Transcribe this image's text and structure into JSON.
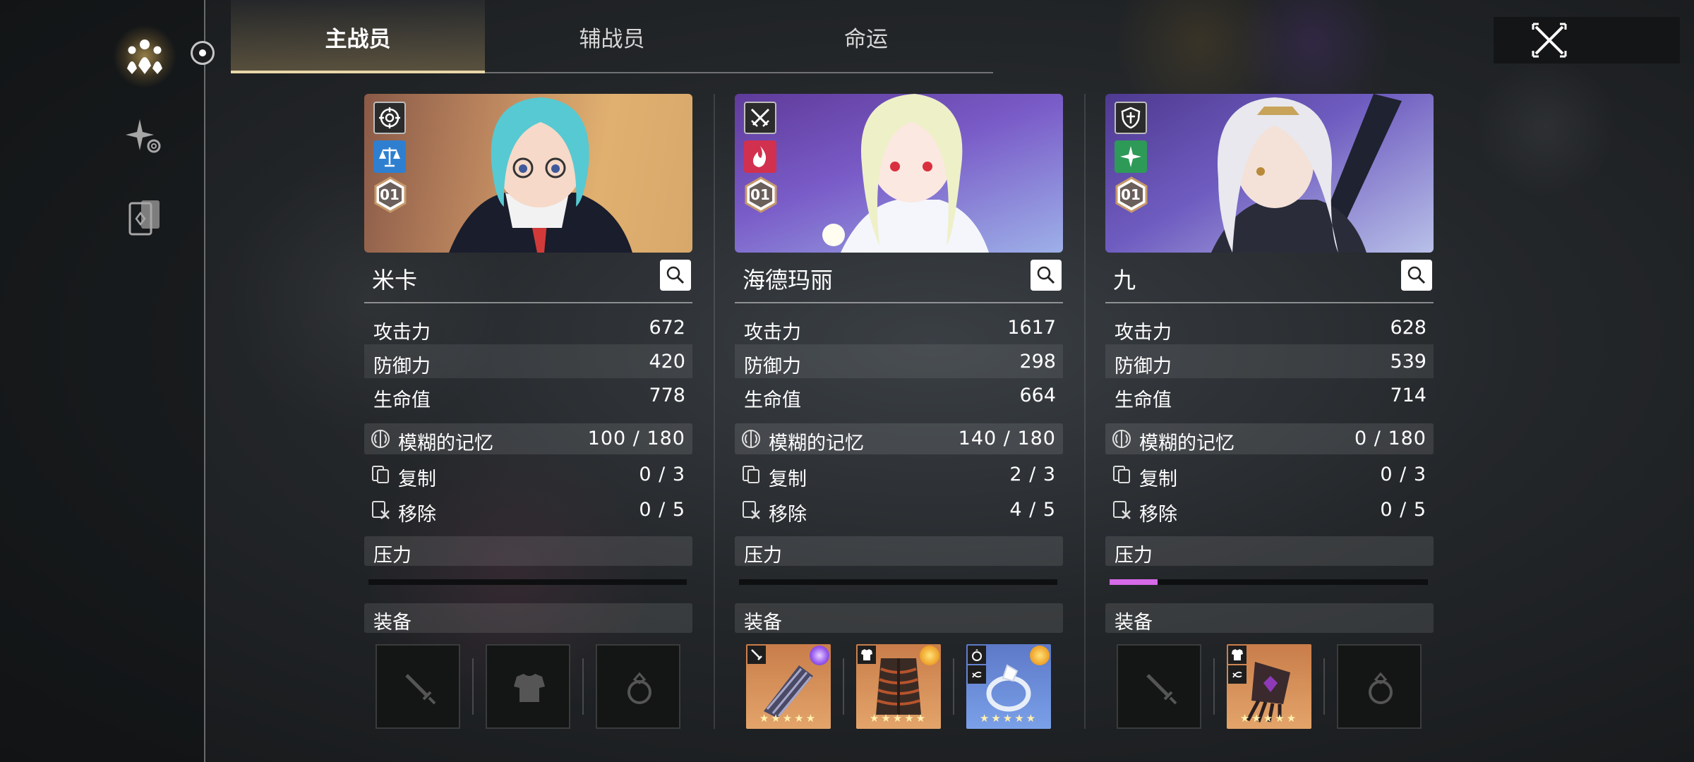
{
  "tabs": [
    {
      "label": "主战员",
      "active": true
    },
    {
      "label": "辅战员",
      "active": false
    },
    {
      "label": "命运",
      "active": false
    }
  ],
  "sidebar": {
    "items": [
      {
        "icon": "crew-icon",
        "active": true
      },
      {
        "icon": "sparkle-icon",
        "active": false
      },
      {
        "icon": "card-deck-icon",
        "active": false
      }
    ]
  },
  "colors": {
    "accent": "#e8d7a8",
    "stress_fill": "#d66ae8",
    "panel": "rgba(255,255,255,0.10)"
  },
  "characters": [
    {
      "name": "米卡",
      "class_icon": "target-icon",
      "element_icon": "scales-icon",
      "element_color": "#2f7fd0",
      "rank": "01",
      "stats": [
        {
          "label": "攻击力",
          "value": "672"
        },
        {
          "label": "防御力",
          "value": "420"
        },
        {
          "label": "生命值",
          "value": "778"
        }
      ],
      "memory": {
        "label": "模糊的记忆",
        "value": "100 / 180"
      },
      "copy": {
        "label": "复制",
        "value": "0 / 3"
      },
      "remove": {
        "label": "移除",
        "value": "0 / 5"
      },
      "stress": {
        "label": "压力",
        "level": 0
      },
      "equip_label": "装备",
      "equipment": [
        {
          "type": "weapon",
          "empty": true,
          "icon": "sword-icon"
        },
        {
          "type": "armor",
          "empty": true,
          "icon": "armor-icon"
        },
        {
          "type": "ring",
          "empty": true,
          "icon": "ring-icon"
        }
      ]
    },
    {
      "name": "海德玛丽",
      "class_icon": "crossed-swords-icon",
      "element_icon": "flame-icon",
      "element_color": "#d2304f",
      "rank": "01",
      "stats": [
        {
          "label": "攻击力",
          "value": "1617"
        },
        {
          "label": "防御力",
          "value": "298"
        },
        {
          "label": "生命值",
          "value": "664"
        }
      ],
      "memory": {
        "label": "模糊的记忆",
        "value": "140 / 180"
      },
      "copy": {
        "label": "复制",
        "value": "2 / 3"
      },
      "remove": {
        "label": "移除",
        "value": "4 / 5"
      },
      "stress": {
        "label": "压力",
        "level": 0
      },
      "equip_label": "装备",
      "equipment": [
        {
          "type": "weapon",
          "empty": false,
          "rarity": "orange",
          "art": "gauntlet-icon",
          "badge": "swirl",
          "stars": "★★★★★"
        },
        {
          "type": "armor",
          "empty": false,
          "rarity": "orange",
          "art": "ribcage-armor-icon",
          "badge": "sun",
          "stars": "★★★★★"
        },
        {
          "type": "ring",
          "empty": false,
          "rarity": "blue",
          "art": "diamond-ring-icon",
          "badge": "sun",
          "stars": "★★★★★"
        }
      ]
    },
    {
      "name": "九",
      "class_icon": "shield-icon",
      "element_icon": "star-cross-icon",
      "element_color": "#2e9a58",
      "rank": "01",
      "stats": [
        {
          "label": "攻击力",
          "value": "628"
        },
        {
          "label": "防御力",
          "value": "539"
        },
        {
          "label": "生命值",
          "value": "714"
        }
      ],
      "memory": {
        "label": "模糊的记忆",
        "value": "0 / 180"
      },
      "copy": {
        "label": "复制",
        "value": "0 / 3"
      },
      "remove": {
        "label": "移除",
        "value": "0 / 5"
      },
      "stress": {
        "label": "压力",
        "level": 0.15
      },
      "equip_label": "装备",
      "equipment": [
        {
          "type": "weapon",
          "empty": true,
          "icon": "sword-icon"
        },
        {
          "type": "armor",
          "empty": false,
          "rarity": "orange",
          "art": "claw-armor-icon",
          "badge": "none",
          "stars": "★★★★★"
        },
        {
          "type": "ring",
          "empty": true,
          "icon": "ring-icon"
        }
      ]
    }
  ]
}
